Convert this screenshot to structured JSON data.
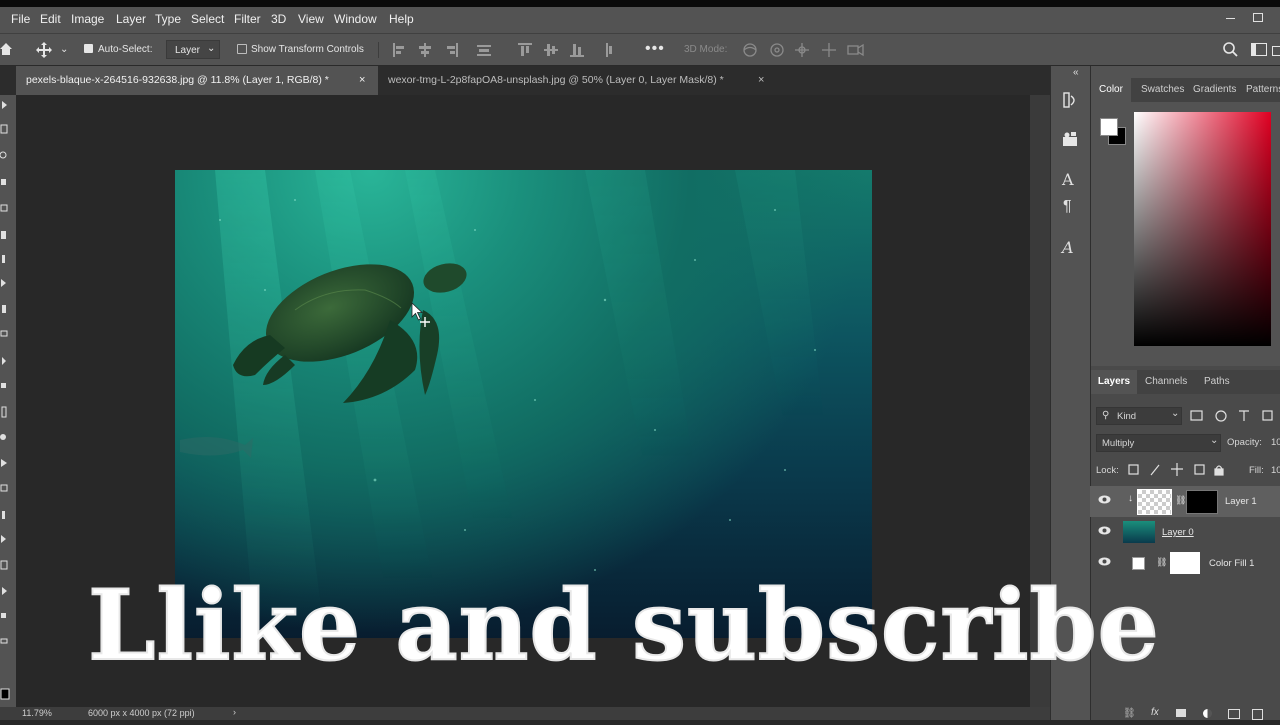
{
  "menu": [
    "File",
    "Edit",
    "Image",
    "Layer",
    "Type",
    "Select",
    "Filter",
    "3D",
    "View",
    "Window",
    "Help"
  ],
  "options_bar": {
    "auto_select_label": "Auto-Select:",
    "auto_select_value": "Layer",
    "show_transform_label": "Show Transform Controls",
    "mode_3d_label": "3D Mode:"
  },
  "tabs": [
    {
      "label": "pexels-blaque-x-264516-932638.jpg @ 11.8% (Layer 1, RGB/8) *",
      "close": "×"
    },
    {
      "label": "wexor-tmg-L-2p8fapOA8-unsplash.jpg @ 50% (Layer 0, Layer Mask/8) *",
      "close": "×"
    }
  ],
  "status": {
    "zoom": "11.79%",
    "doc_size": "6000 px x 4000 px (72 ppi)"
  },
  "color_panel": {
    "tabs": [
      "Color",
      "Swatches",
      "Gradients",
      "Patterns"
    ],
    "collapse_glyph": "«"
  },
  "layers_panel": {
    "tabs": [
      "Layers",
      "Channels",
      "Paths"
    ],
    "filter_kind": "Kind",
    "blend_mode": "Multiply",
    "opacity_label": "Opacity:",
    "opacity_value": "10",
    "lock_label": "Lock:",
    "fill_label": "Fill:",
    "fill_value": "10",
    "layers": [
      {
        "name": "Layer 1"
      },
      {
        "name": "Layer 0"
      },
      {
        "name": "Color Fill 1"
      }
    ]
  },
  "overlay_caption": "Llike and subscribe",
  "colors": {
    "panel_bg": "#535353",
    "canvas_bg": "#282828",
    "foreground": "#ffffff",
    "background": "#000000",
    "picker_hue": "#e00022"
  }
}
